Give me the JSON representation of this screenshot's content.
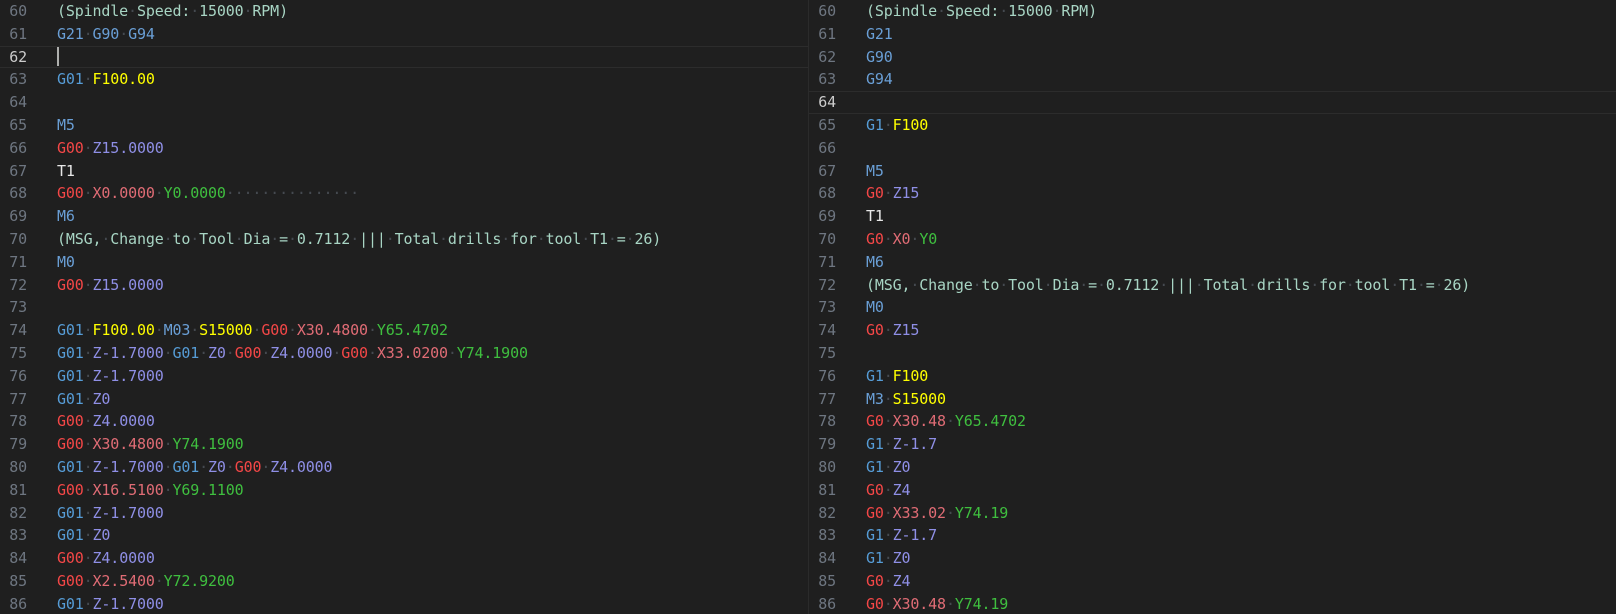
{
  "colors": {
    "background": "#1f1f1f",
    "line_number": "#6e7681",
    "line_number_active": "#cccccc",
    "whitespace_dot": "#454a50",
    "g_blue": "#569cd6",
    "g_red": "#f44747",
    "m_code": "#6a9fd6",
    "feed_yellow": "#ffff00",
    "x_coord": "#e06c75",
    "y_coord": "#3fbf3f",
    "z_coord": "#8f8fe6",
    "comment": "#a8d5c4",
    "tool": "#e8e8e8"
  },
  "left_pane": {
    "current_line": "62",
    "lines": [
      {
        "n": "60",
        "tokens": [
          {
            "t": "(Spindle Speed: 15000 RPM)",
            "k": "comment"
          }
        ]
      },
      {
        "n": "61",
        "tokens": [
          {
            "t": "G21",
            "k": "m_code"
          },
          {
            "t": "G90",
            "k": "m_code"
          },
          {
            "t": "G94",
            "k": "m_code"
          }
        ]
      },
      {
        "n": "62",
        "tokens": [],
        "cursor": true
      },
      {
        "n": "63",
        "tokens": [
          {
            "t": "G01",
            "k": "g_blue"
          },
          {
            "t": "F100.00",
            "k": "feed_yellow"
          }
        ]
      },
      {
        "n": "64",
        "tokens": []
      },
      {
        "n": "65",
        "tokens": [
          {
            "t": "M5",
            "k": "m_code"
          }
        ]
      },
      {
        "n": "66",
        "tokens": [
          {
            "t": "G00",
            "k": "g_red"
          },
          {
            "t": "Z15.0000",
            "k": "z_coord"
          }
        ]
      },
      {
        "n": "67",
        "tokens": [
          {
            "t": "T1",
            "k": "tool"
          }
        ]
      },
      {
        "n": "68",
        "tokens": [
          {
            "t": "G00",
            "k": "g_red"
          },
          {
            "t": "X0.0000",
            "k": "x_coord"
          },
          {
            "t": "Y0.0000",
            "k": "y_coord"
          }
        ],
        "trail": "···············"
      },
      {
        "n": "69",
        "tokens": [
          {
            "t": "M6",
            "k": "m_code"
          }
        ]
      },
      {
        "n": "70",
        "tokens": [
          {
            "t": "(MSG, Change to Tool Dia = 0.7112 ||| Total drills for tool T1 = 26)",
            "k": "comment"
          }
        ]
      },
      {
        "n": "71",
        "tokens": [
          {
            "t": "M0",
            "k": "m_code"
          }
        ]
      },
      {
        "n": "72",
        "tokens": [
          {
            "t": "G00",
            "k": "g_red"
          },
          {
            "t": "Z15.0000",
            "k": "z_coord"
          }
        ]
      },
      {
        "n": "73",
        "tokens": []
      },
      {
        "n": "74",
        "tokens": [
          {
            "t": "G01",
            "k": "g_blue"
          },
          {
            "t": "F100.00",
            "k": "feed_yellow"
          },
          {
            "t": "M03",
            "k": "m_code"
          },
          {
            "t": "S15000",
            "k": "feed_yellow"
          },
          {
            "t": "G00",
            "k": "g_red"
          },
          {
            "t": "X30.4800",
            "k": "x_coord"
          },
          {
            "t": "Y65.4702",
            "k": "y_coord"
          }
        ]
      },
      {
        "n": "75",
        "tokens": [
          {
            "t": "G01",
            "k": "g_blue"
          },
          {
            "t": "Z-1.7000",
            "k": "z_coord"
          },
          {
            "t": "G01",
            "k": "g_blue"
          },
          {
            "t": "Z0",
            "k": "z_coord"
          },
          {
            "t": "G00",
            "k": "g_red"
          },
          {
            "t": "Z4.0000",
            "k": "z_coord"
          },
          {
            "t": "G00",
            "k": "g_red"
          },
          {
            "t": "X33.0200",
            "k": "x_coord"
          },
          {
            "t": "Y74.1900",
            "k": "y_coord"
          }
        ]
      },
      {
        "n": "76",
        "tokens": [
          {
            "t": "G01",
            "k": "g_blue"
          },
          {
            "t": "Z-1.7000",
            "k": "z_coord"
          }
        ]
      },
      {
        "n": "77",
        "tokens": [
          {
            "t": "G01",
            "k": "g_blue"
          },
          {
            "t": "Z0",
            "k": "z_coord"
          }
        ]
      },
      {
        "n": "78",
        "tokens": [
          {
            "t": "G00",
            "k": "g_red"
          },
          {
            "t": "Z4.0000",
            "k": "z_coord"
          }
        ]
      },
      {
        "n": "79",
        "tokens": [
          {
            "t": "G00",
            "k": "g_red"
          },
          {
            "t": "X30.4800",
            "k": "x_coord"
          },
          {
            "t": "Y74.1900",
            "k": "y_coord"
          }
        ]
      },
      {
        "n": "80",
        "tokens": [
          {
            "t": "G01",
            "k": "g_blue"
          },
          {
            "t": "Z-1.7000",
            "k": "z_coord"
          },
          {
            "t": "G01",
            "k": "g_blue"
          },
          {
            "t": "Z0",
            "k": "z_coord"
          },
          {
            "t": "G00",
            "k": "g_red"
          },
          {
            "t": "Z4.0000",
            "k": "z_coord"
          }
        ]
      },
      {
        "n": "81",
        "tokens": [
          {
            "t": "G00",
            "k": "g_red"
          },
          {
            "t": "X16.5100",
            "k": "x_coord"
          },
          {
            "t": "Y69.1100",
            "k": "y_coord"
          }
        ]
      },
      {
        "n": "82",
        "tokens": [
          {
            "t": "G01",
            "k": "g_blue"
          },
          {
            "t": "Z-1.7000",
            "k": "z_coord"
          }
        ]
      },
      {
        "n": "83",
        "tokens": [
          {
            "t": "G01",
            "k": "g_blue"
          },
          {
            "t": "Z0",
            "k": "z_coord"
          }
        ]
      },
      {
        "n": "84",
        "tokens": [
          {
            "t": "G00",
            "k": "g_red"
          },
          {
            "t": "Z4.0000",
            "k": "z_coord"
          }
        ]
      },
      {
        "n": "85",
        "tokens": [
          {
            "t": "G00",
            "k": "g_red"
          },
          {
            "t": "X2.5400",
            "k": "x_coord"
          },
          {
            "t": "Y72.9200",
            "k": "y_coord"
          }
        ]
      },
      {
        "n": "86",
        "tokens": [
          {
            "t": "G01",
            "k": "g_blue"
          },
          {
            "t": "Z-1.7000",
            "k": "z_coord"
          }
        ]
      }
    ]
  },
  "right_pane": {
    "current_line": "64",
    "lines": [
      {
        "n": "60",
        "tokens": [
          {
            "t": "(Spindle Speed: 15000 RPM)",
            "k": "comment"
          }
        ]
      },
      {
        "n": "61",
        "tokens": [
          {
            "t": "G21",
            "k": "m_code"
          }
        ]
      },
      {
        "n": "62",
        "tokens": [
          {
            "t": "G90",
            "k": "m_code"
          }
        ]
      },
      {
        "n": "63",
        "tokens": [
          {
            "t": "G94",
            "k": "m_code"
          }
        ]
      },
      {
        "n": "64",
        "tokens": []
      },
      {
        "n": "65",
        "tokens": [
          {
            "t": "G1",
            "k": "g_blue"
          },
          {
            "t": "F100",
            "k": "feed_yellow"
          }
        ]
      },
      {
        "n": "66",
        "tokens": []
      },
      {
        "n": "67",
        "tokens": [
          {
            "t": "M5",
            "k": "m_code"
          }
        ]
      },
      {
        "n": "68",
        "tokens": [
          {
            "t": "G0",
            "k": "g_red"
          },
          {
            "t": "Z15",
            "k": "z_coord"
          }
        ]
      },
      {
        "n": "69",
        "tokens": [
          {
            "t": "T1",
            "k": "tool"
          }
        ]
      },
      {
        "n": "70",
        "tokens": [
          {
            "t": "G0",
            "k": "g_red"
          },
          {
            "t": "X0",
            "k": "x_coord"
          },
          {
            "t": "Y0",
            "k": "y_coord"
          }
        ]
      },
      {
        "n": "71",
        "tokens": [
          {
            "t": "M6",
            "k": "m_code"
          }
        ]
      },
      {
        "n": "72",
        "tokens": [
          {
            "t": "(MSG, Change to Tool Dia = 0.7112 ||| Total drills for tool T1 = 26)",
            "k": "comment"
          }
        ]
      },
      {
        "n": "73",
        "tokens": [
          {
            "t": "M0",
            "k": "m_code"
          }
        ]
      },
      {
        "n": "74",
        "tokens": [
          {
            "t": "G0",
            "k": "g_red"
          },
          {
            "t": "Z15",
            "k": "z_coord"
          }
        ]
      },
      {
        "n": "75",
        "tokens": []
      },
      {
        "n": "76",
        "tokens": [
          {
            "t": "G1",
            "k": "g_blue"
          },
          {
            "t": "F100",
            "k": "feed_yellow"
          }
        ]
      },
      {
        "n": "77",
        "tokens": [
          {
            "t": "M3",
            "k": "m_code"
          },
          {
            "t": "S15000",
            "k": "feed_yellow"
          }
        ]
      },
      {
        "n": "78",
        "tokens": [
          {
            "t": "G0",
            "k": "g_red"
          },
          {
            "t": "X30.48",
            "k": "x_coord"
          },
          {
            "t": "Y65.4702",
            "k": "y_coord"
          }
        ]
      },
      {
        "n": "79",
        "tokens": [
          {
            "t": "G1",
            "k": "g_blue"
          },
          {
            "t": "Z-1.7",
            "k": "z_coord"
          }
        ]
      },
      {
        "n": "80",
        "tokens": [
          {
            "t": "G1",
            "k": "g_blue"
          },
          {
            "t": "Z0",
            "k": "z_coord"
          }
        ]
      },
      {
        "n": "81",
        "tokens": [
          {
            "t": "G0",
            "k": "g_red"
          },
          {
            "t": "Z4",
            "k": "z_coord"
          }
        ]
      },
      {
        "n": "82",
        "tokens": [
          {
            "t": "G0",
            "k": "g_red"
          },
          {
            "t": "X33.02",
            "k": "x_coord"
          },
          {
            "t": "Y74.19",
            "k": "y_coord"
          }
        ]
      },
      {
        "n": "83",
        "tokens": [
          {
            "t": "G1",
            "k": "g_blue"
          },
          {
            "t": "Z-1.7",
            "k": "z_coord"
          }
        ]
      },
      {
        "n": "84",
        "tokens": [
          {
            "t": "G1",
            "k": "g_blue"
          },
          {
            "t": "Z0",
            "k": "z_coord"
          }
        ]
      },
      {
        "n": "85",
        "tokens": [
          {
            "t": "G0",
            "k": "g_red"
          },
          {
            "t": "Z4",
            "k": "z_coord"
          }
        ]
      },
      {
        "n": "86",
        "tokens": [
          {
            "t": "G0",
            "k": "g_red"
          },
          {
            "t": "X30.48",
            "k": "x_coord"
          },
          {
            "t": "Y74.19",
            "k": "y_coord"
          }
        ]
      }
    ]
  }
}
